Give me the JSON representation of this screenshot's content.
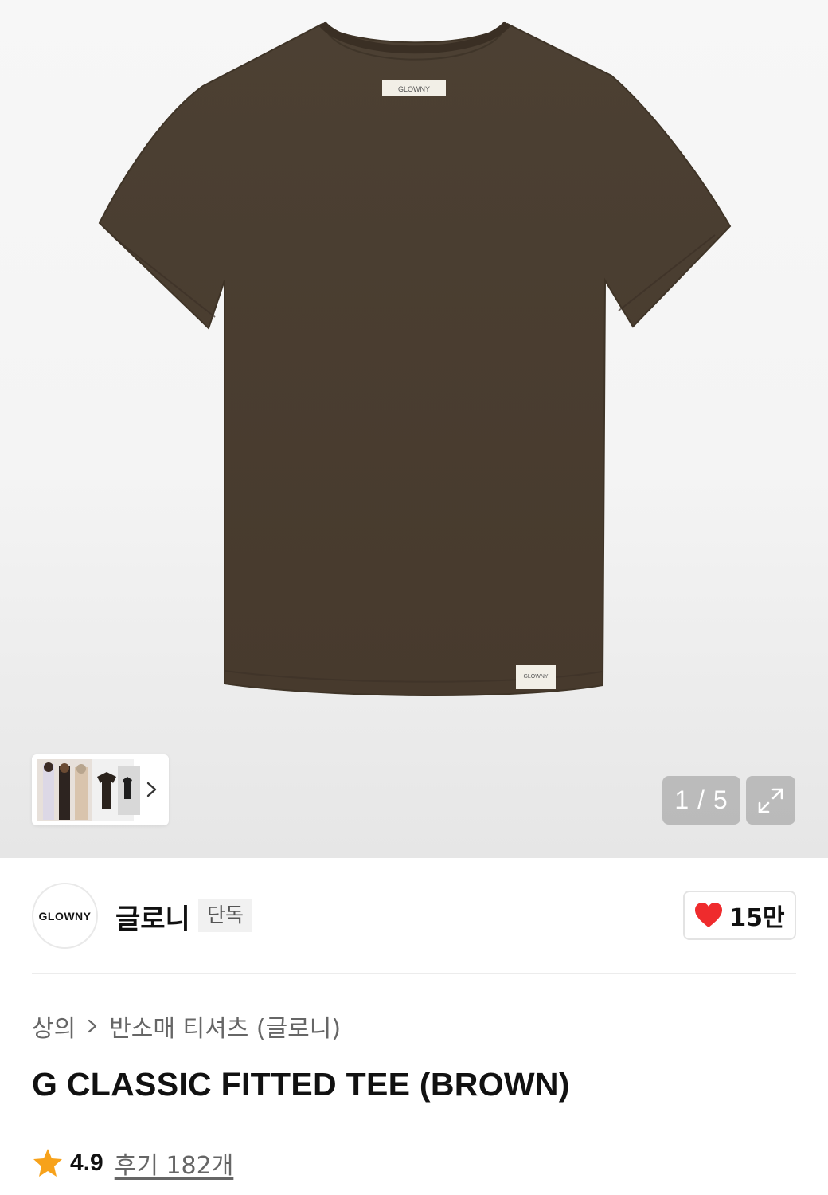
{
  "gallery": {
    "page_indicator": "1 / 5",
    "tag_text": "GLOWNY",
    "hem_tag_text": "GLOWNY",
    "colors": {
      "shirt": "#4a3d2f",
      "background": "#f5f5f5"
    }
  },
  "brand": {
    "logo_text": "GLOWNY",
    "name": "글로니",
    "badge": "단독",
    "likes": "15만"
  },
  "breadcrumb": {
    "items": [
      "상의",
      "반소매 티셔츠 (글로니)"
    ]
  },
  "product": {
    "title": "G CLASSIC FITTED TEE (BROWN)",
    "rating": "4.9",
    "reviews_label": "후기 182개"
  },
  "colors": {
    "accent_heart": "#ef2b2d",
    "star": "#f7a21b"
  }
}
